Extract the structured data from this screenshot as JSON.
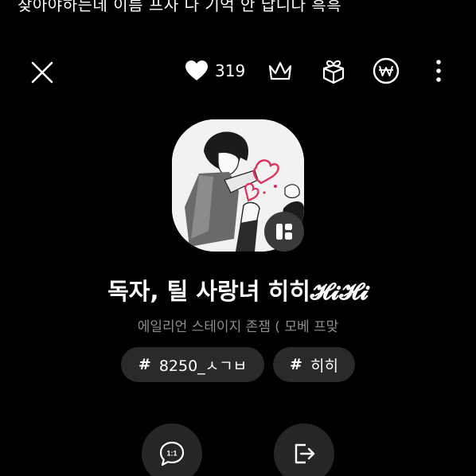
{
  "caption": "찾아야하는데 이름 프사 나 기억 안 납니다 흑흑",
  "topbar": {
    "close_icon": "close-icon",
    "like_icon": "heart-icon",
    "like_count": "319",
    "crown_icon": "crown-icon",
    "gift_icon": "gift-box-icon",
    "won_icon": "won-coin-icon",
    "more_icon": "more-vertical-icon"
  },
  "profile": {
    "avatar_icon": "profile-image",
    "badge_icon": "gallery-icon",
    "title": "독자, 틸 사랑녀 히히𝓗𝓲𝓗𝓲",
    "subtitle": "에일리언 스테이지 존잼 ( 모베 프맞"
  },
  "tags": [
    {
      "hash": "#",
      "label": "8250_ㅅㄱㅂ"
    },
    {
      "hash": "#",
      "label": "히히"
    }
  ],
  "actions": {
    "chat_icon": "chat-1to1-icon",
    "chat_label": "1:1",
    "share_icon": "exit-share-icon"
  },
  "colors": {
    "background": "#000000",
    "tag_bg": "#2a2a2a",
    "subtitle": "#8d8d8d",
    "badge_bg": "#3a3a3a"
  }
}
